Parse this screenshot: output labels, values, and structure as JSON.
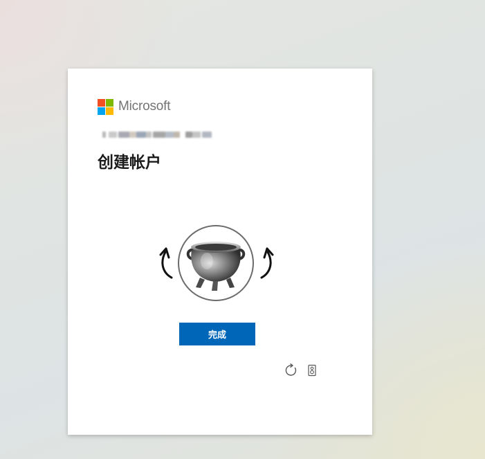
{
  "brand": {
    "name": "Microsoft",
    "logo_colors": [
      "#f25022",
      "#7fba00",
      "#00a4ef",
      "#ffb900"
    ]
  },
  "account": {
    "identity": ""
  },
  "page": {
    "title": "创建帐户",
    "instruction": "",
    "instruction_obscured": true
  },
  "puzzle": {
    "image_subject": "cauldron",
    "rotate_left_icon": "rotate-left-arrow-icon",
    "rotate_right_icon": "rotate-right-arrow-icon"
  },
  "actions": {
    "done_label": "完成",
    "button_color": "#0067b8"
  },
  "tools": [
    {
      "name": "refresh-icon"
    },
    {
      "name": "audio-challenge-icon"
    }
  ]
}
